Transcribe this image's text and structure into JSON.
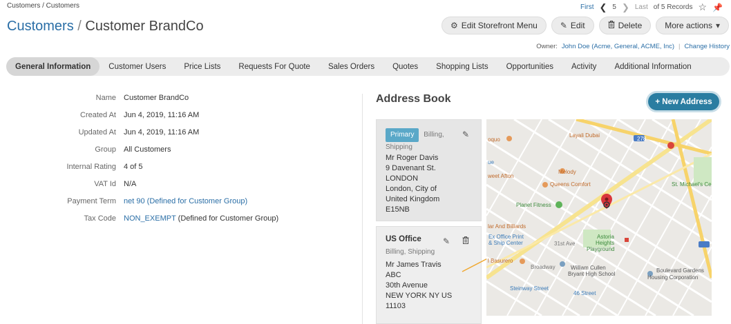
{
  "breadcrumb": "Customers / Customers",
  "pager": {
    "first": "First",
    "current": "5",
    "last": "Last",
    "of_records": "of 5 Records"
  },
  "header": {
    "crumb": "Customers",
    "separator": "/",
    "title": "Customer BrandCo"
  },
  "actions": {
    "edit_storefront": "Edit Storefront Menu",
    "edit": "Edit",
    "delete": "Delete",
    "more": "More actions"
  },
  "owner": {
    "label": "Owner:",
    "value": "John Doe (Acme, General, ACME, Inc)",
    "change_history": "Change History"
  },
  "tabs": [
    {
      "label": "General Information",
      "active": true
    },
    {
      "label": "Customer Users"
    },
    {
      "label": "Price Lists"
    },
    {
      "label": "Requests For Quote"
    },
    {
      "label": "Sales Orders"
    },
    {
      "label": "Quotes"
    },
    {
      "label": "Shopping Lists"
    },
    {
      "label": "Opportunities"
    },
    {
      "label": "Activity"
    },
    {
      "label": "Additional Information"
    }
  ],
  "info": {
    "name_label": "Name",
    "name": "Customer BrandCo",
    "created_label": "Created At",
    "created": "Jun 4, 2019, 11:16 AM",
    "updated_label": "Updated At",
    "updated": "Jun 4, 2019, 11:16 AM",
    "group_label": "Group",
    "group": "All Customers",
    "rating_label": "Internal Rating",
    "rating": "4 of 5",
    "vat_label": "VAT Id",
    "vat": "N/A",
    "payment_label": "Payment Term",
    "payment_link": "net 90",
    "payment_open": " (",
    "payment_note": "Defined for Customer Group",
    "payment_close": ")",
    "tax_label": "Tax Code",
    "tax_link": "NON_EXEMPT",
    "tax_note": " (Defined for Customer Group)"
  },
  "address_book": {
    "title": "Address Book",
    "new_button": "+ New Address",
    "addresses": [
      {
        "badge": "Primary",
        "types": "Billing,",
        "types2": "Shipping",
        "lines": [
          "Mr Roger Davis",
          "9 Davenant St.",
          "LONDON",
          "London, City of",
          "United Kingdom",
          "E15NB"
        ]
      },
      {
        "label": "US Office",
        "types": "Billing, Shipping",
        "lines": [
          "Mr James Travis",
          "ABC",
          "30th Avenue",
          "NEW YORK NY US",
          "11103"
        ]
      }
    ]
  },
  "map": {
    "labels": [
      "Layali Dubai",
      "oquo",
      "ue",
      "weet Afton",
      "Melody",
      "Queens Comfort",
      "Planet Fitness",
      "St. Michael's Ce",
      "lar And Billiards",
      "Ex Office Print",
      "& Ship Center",
      "Astoria",
      "Heights",
      "Playground",
      "William Cullen",
      "Bryant High School",
      "Boulevard Gardens",
      "Housing Corporation",
      "l Basurero",
      "Steinway Street",
      "46 Street",
      "Broadway",
      "31st Ave",
      "278"
    ]
  }
}
